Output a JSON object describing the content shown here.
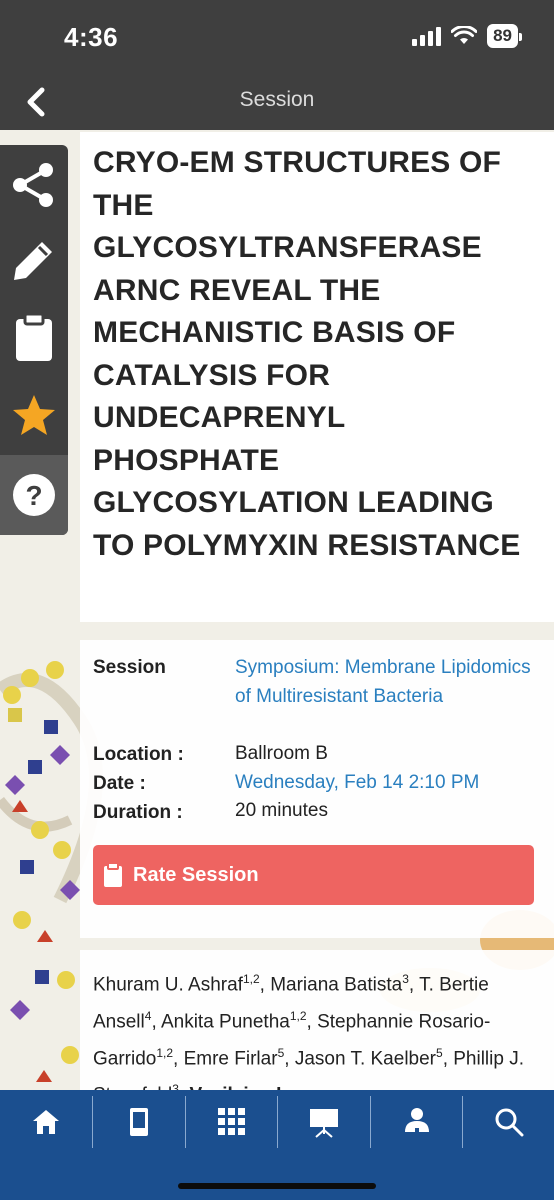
{
  "status": {
    "time": "4:36",
    "battery": "89"
  },
  "header": {
    "title": "Session"
  },
  "side_toolbar": {
    "tools": [
      "share-icon",
      "pencil-icon",
      "clipboard-icon",
      "star-icon",
      "help-icon"
    ],
    "star_color": "#f5a623"
  },
  "session": {
    "title": "CRYO-EM STRUCTURES OF THE GLYCOSYLTRANSFERASE ARNC REVEAL THE MECHANISTIC BASIS OF CATALYSIS FOR UNDECAPRENYL PHOSPHATE GLYCOSYLATION LEADING TO POLYMYXIN RESISTANCE",
    "session_label": "Session",
    "session_value": "Symposium: Membrane Lipidomics of Multiresistant Bacteria",
    "location_label": "Location :",
    "location_value": "Ballroom B",
    "date_label": "Date :",
    "date_value": "Wednesday, Feb 14 2:10 PM",
    "duration_label": "Duration :",
    "duration_value": "20 minutes",
    "rate_label": "Rate Session"
  },
  "authors": {
    "list": [
      {
        "name": "Khuram U. Ashraf",
        "sup": "1,2"
      },
      {
        "name": "Mariana Batista",
        "sup": "3"
      },
      {
        "name": "T. Bertie Ansell",
        "sup": "4"
      },
      {
        "name": "Ankita Punetha",
        "sup": "1,2"
      },
      {
        "name": "Stephannie Rosario-Garrido",
        "sup": "1,2"
      },
      {
        "name": "Emre Firlar",
        "sup": "5"
      },
      {
        "name": "Jason T. Kaelber",
        "sup": "5"
      },
      {
        "name": "Phillip J. Stansfeld",
        "sup": "3"
      },
      {
        "name": "Vasileios I.",
        "sup": "",
        "bold": true
      }
    ]
  },
  "bottom_nav": {
    "items": [
      "home-icon",
      "mobile-icon",
      "grid-icon",
      "presentation-icon",
      "speaker-icon",
      "search-icon"
    ]
  },
  "colors": {
    "header_bg": "#3f3f3f",
    "nav_bg": "#1b4f8f",
    "link": "#2a7fbf",
    "rate_button": "#ee6461"
  }
}
